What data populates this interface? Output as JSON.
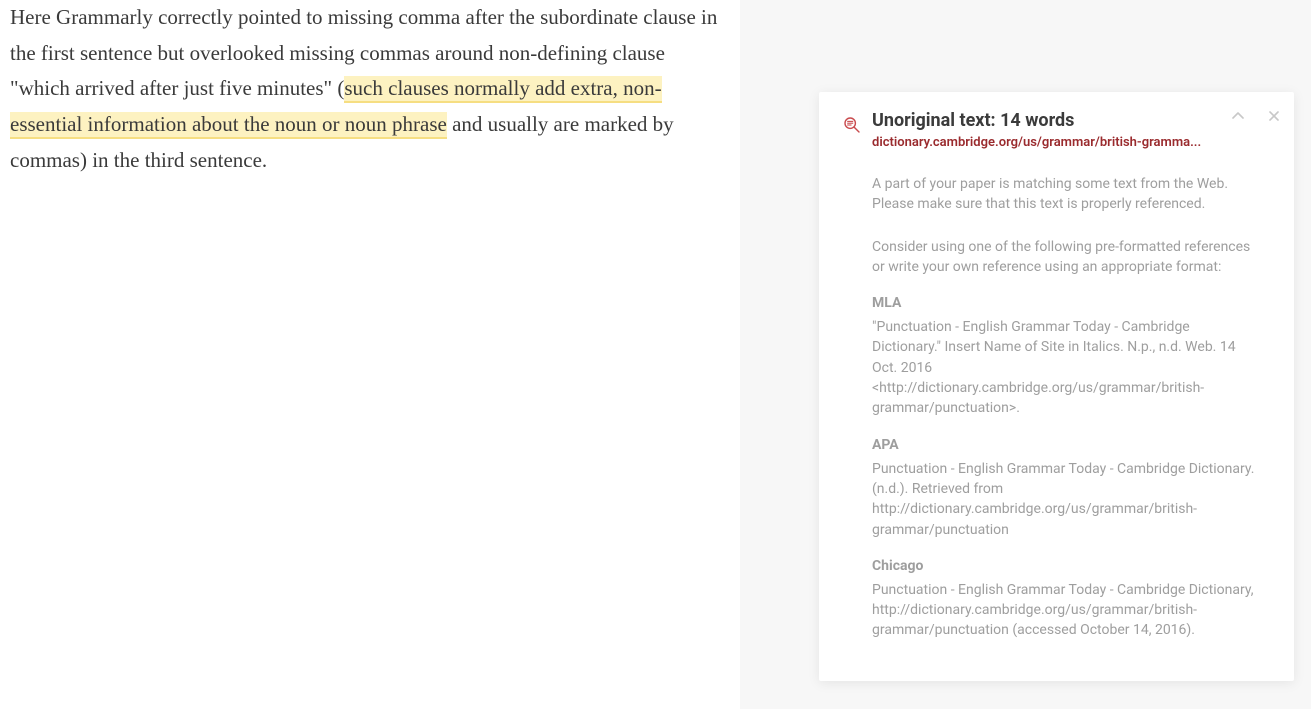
{
  "editor": {
    "text_before": "Here Grammarly correctly pointed to missing comma after the subordinate clause in the first sentence but overlooked missing commas around non-defining clause \"which arrived after just five minutes\" (",
    "highlighted": "such clauses normally add extra, non-essential information about the noun or noun phrase",
    "text_after": " and usually are marked by commas) in the third sentence."
  },
  "panel": {
    "title": "Unoriginal text: 14 words",
    "source": "dictionary.cambridge.org/us/grammar/british-gramma...",
    "message1": "A part of your paper is matching some text from the Web. Please make sure that this text is properly referenced.",
    "message2": "Consider using one of the following pre-formatted references or write your own reference using an appropriate format:",
    "formats": [
      {
        "label": "MLA",
        "text": "\"Punctuation - English Grammar Today - Cambridge Dictionary.\" Insert Name of Site in Italics. N.p., n.d. Web. 14 Oct. 2016 <http://dictionary.cambridge.org/us/grammar/british-grammar/punctuation>."
      },
      {
        "label": "APA",
        "text": "Punctuation - English Grammar Today - Cambridge Dictionary. (n.d.). Retrieved from http://dictionary.cambridge.org/us/grammar/british-grammar/punctuation"
      },
      {
        "label": "Chicago",
        "text": "Punctuation - English Grammar Today - Cambridge Dictionary, http://dictionary.cambridge.org/us/grammar/british-grammar/punctuation (accessed October 14, 2016)."
      }
    ]
  }
}
